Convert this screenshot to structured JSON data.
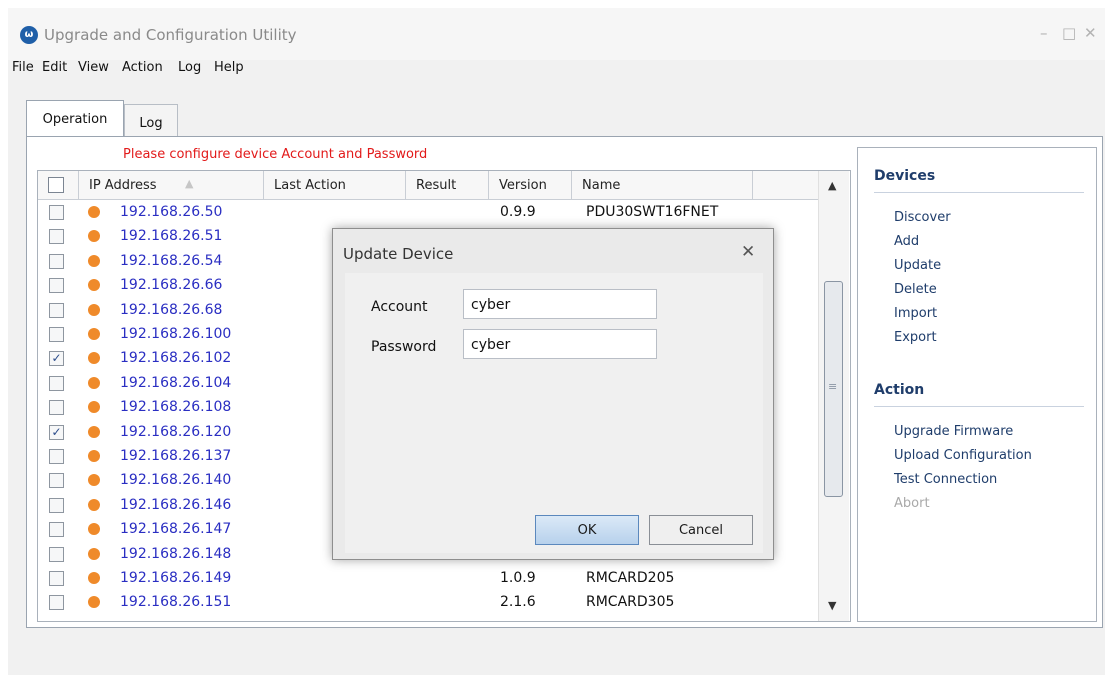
{
  "window": {
    "title": "Upgrade and Configuration Utility",
    "icon": "app-logo-icon",
    "minimize": "–",
    "maximize": "□",
    "close": "✕"
  },
  "menu": [
    "File",
    "Edit",
    "View",
    "Action",
    "Log",
    "Help"
  ],
  "tabs": [
    {
      "label": "Operation"
    },
    {
      "label": "Log"
    }
  ],
  "warning": "Please configure device Account and Password",
  "table": {
    "columns": [
      "IP Address",
      "Last Action",
      "Result",
      "Version",
      "Name"
    ],
    "sort_indicator": "▲",
    "rows": [
      {
        "check": "",
        "ip": "192.168.26.50",
        "version": "0.9.9",
        "name": "PDU30SWT16FNET"
      },
      {
        "check": "",
        "ip": "192.168.26.51",
        "version": "",
        "name": ""
      },
      {
        "check": "",
        "ip": "192.168.26.54",
        "version": "",
        "name": ""
      },
      {
        "check": "",
        "ip": "192.168.26.66",
        "version": "",
        "name": ""
      },
      {
        "check": "",
        "ip": "192.168.26.68",
        "version": "",
        "name": ""
      },
      {
        "check": "",
        "ip": "192.168.26.100",
        "version": "",
        "name": ""
      },
      {
        "check": "✓",
        "ip": "192.168.26.102",
        "version": "",
        "name": ""
      },
      {
        "check": "",
        "ip": "192.168.26.104",
        "version": "",
        "name": ""
      },
      {
        "check": "",
        "ip": "192.168.26.108",
        "version": "",
        "name": ""
      },
      {
        "check": "✓",
        "ip": "192.168.26.120",
        "version": "",
        "name": ""
      },
      {
        "check": "",
        "ip": "192.168.26.137",
        "version": "",
        "name": ""
      },
      {
        "check": "",
        "ip": "192.168.26.140",
        "version": "",
        "name": ""
      },
      {
        "check": "",
        "ip": "192.168.26.146",
        "version": "",
        "name": ""
      },
      {
        "check": "",
        "ip": "192.168.26.147",
        "version": "",
        "name": ""
      },
      {
        "check": "",
        "ip": "192.168.26.148",
        "version": "",
        "name": ""
      },
      {
        "check": "",
        "ip": "192.168.26.149",
        "version": "1.0.9",
        "name": "RMCARD205"
      },
      {
        "check": "",
        "ip": "192.168.26.151",
        "version": "2.1.6",
        "name": "RMCARD305"
      }
    ]
  },
  "scroll": {
    "up": "▲",
    "down": "▼",
    "grip": "≡"
  },
  "sidebar": {
    "devices": {
      "title": "Devices",
      "items": [
        "Discover",
        "Add",
        "Update",
        "Delete",
        "Import",
        "Export"
      ]
    },
    "action": {
      "title": "Action",
      "items": [
        "Upgrade Firmware",
        "Upload Configuration",
        "Test Connection",
        "Abort"
      ]
    }
  },
  "dialog": {
    "title": "Update Device",
    "close": "✕",
    "account_label": "Account",
    "account_value": "cyber",
    "password_label": "Password",
    "password_value": "cyber",
    "ok": "OK",
    "cancel": "Cancel"
  },
  "colors": {
    "accent": "#1f3d6b",
    "warning": "#e21a1a",
    "ip_link": "#2a2ec2",
    "status_dot": "#ef8a2a"
  }
}
